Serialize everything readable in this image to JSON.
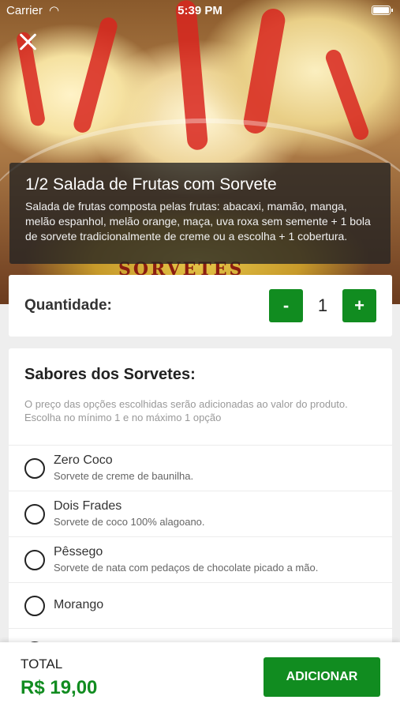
{
  "status_bar": {
    "carrier": "Carrier",
    "time": "5:39 PM"
  },
  "product": {
    "title": "1/2 Salada de Frutas com Sorvete",
    "description": "Salada de frutas composta pelas frutas: abacaxi, mamão, manga, melão espanhol, melão orange, maça, uva roxa sem semente + 1 bola de sorvete tradicionalmente de creme ou a escolha + 1 cobertura.",
    "image_text": "SORVETES"
  },
  "quantity": {
    "label": "Quantidade:",
    "minus": "-",
    "value": "1",
    "plus": "+"
  },
  "flavors": {
    "heading": "Sabores dos Sorvetes:",
    "hint": "O preço das opções escolhidas serão adicionadas ao valor do produto. Escolha no mínimo 1 e no máximo 1 opção",
    "options": [
      {
        "name": "Zero Coco",
        "description": "Sorvete de creme de baunilha."
      },
      {
        "name": "Dois Frades",
        "description": "Sorvete de coco 100% alagoano."
      },
      {
        "name": "Pêssego",
        "description": "Sorvete de nata com pedaços de chocolate picado a mão."
      },
      {
        "name": "Morango",
        "description": ""
      }
    ]
  },
  "footer": {
    "total_label": "TOTAL",
    "total_value": "R$ 19,00",
    "add_button": "ADICIONAR"
  },
  "colors": {
    "accent": "#118c20",
    "overlay": "#232323"
  }
}
